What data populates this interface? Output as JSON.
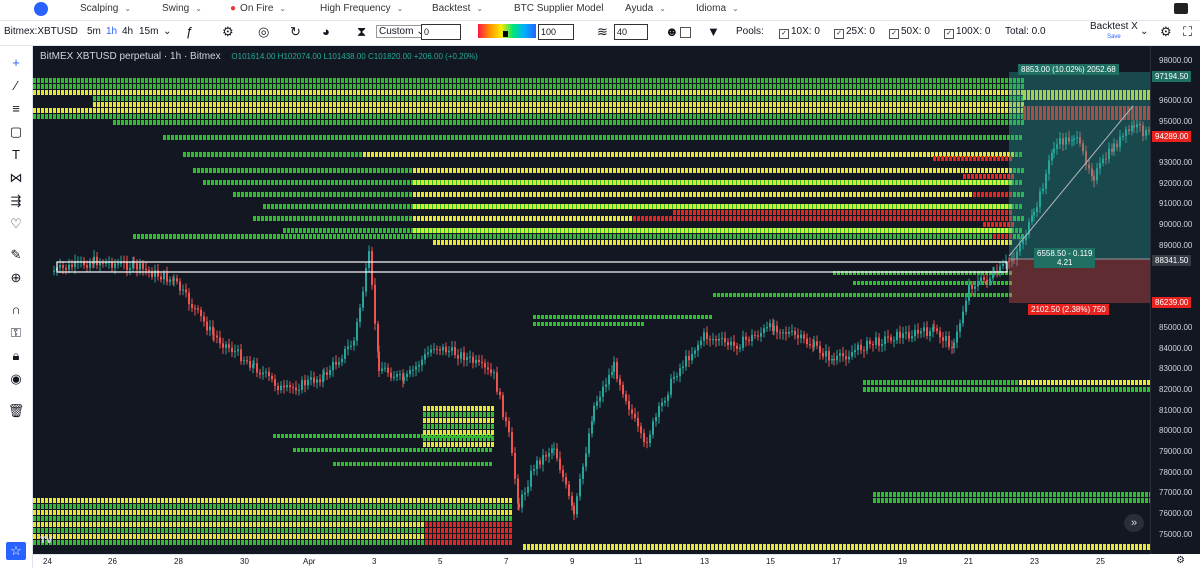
{
  "menu": {
    "items": [
      {
        "label": "Scalping"
      },
      {
        "label": "Swing"
      },
      {
        "label": "On Fire"
      },
      {
        "label": "High Frequency"
      },
      {
        "label": "Backtest"
      },
      {
        "label": "BTC Supplier Model"
      },
      {
        "label": "Ayuda"
      },
      {
        "label": "Idioma"
      }
    ]
  },
  "toolbar": {
    "symbol": "Bitmex:XBTUSD",
    "intervals": [
      "5m",
      "1h",
      "4h",
      "15m"
    ],
    "custom_label": "Custom",
    "custom_value": "0",
    "gradient_value": "100",
    "layers_value": "40",
    "pools_label": "Pools:",
    "pools": [
      {
        "label": "10X: 0"
      },
      {
        "label": "25X: 0"
      },
      {
        "label": "50X: 0"
      },
      {
        "label": "100X: 0"
      }
    ],
    "total_label": "Total: 0.0",
    "backtest_label": "Backtest X",
    "backtest_sub": "Save"
  },
  "chart": {
    "title": "BitMEX XBTUSD perpetual · 1h · Bitmex",
    "ohlc": "O101614.00 H102074.00 L101438.00 C101820.00 +206.00 (+0.20%)",
    "target_label": "8853.00 (10.02%) 2052.68",
    "position_label_1": "6558.50 - 0.119",
    "position_label_2": "4.21",
    "stop_label": "2102.50 (2.38%) 750",
    "colors": {
      "bg": "#131722",
      "yellow": "#e6e62e",
      "green": "#2dbd2d",
      "red": "#e8231f",
      "teal": "#1f6f62",
      "up": "#26a69a",
      "down": "#ef5350"
    }
  },
  "price_axis": {
    "labels": [
      "98000.00",
      "97194.50",
      "96000.00",
      "95000.00",
      "94289.00",
      "93000.00",
      "92000.00",
      "91000.00",
      "90000.00",
      "89000.00",
      "88341.50",
      "86239.00",
      "85000.00",
      "84000.00",
      "83000.00",
      "82000.00",
      "81000.00",
      "80000.00",
      "79000.00",
      "78000.00",
      "77000.00",
      "76000.00",
      "75000.00"
    ]
  },
  "time_axis": {
    "labels": [
      "24",
      "26",
      "28",
      "30",
      "Apr",
      "3",
      "5",
      "7",
      "9",
      "11",
      "13",
      "15",
      "17",
      "19",
      "21",
      "23",
      "25"
    ]
  }
}
